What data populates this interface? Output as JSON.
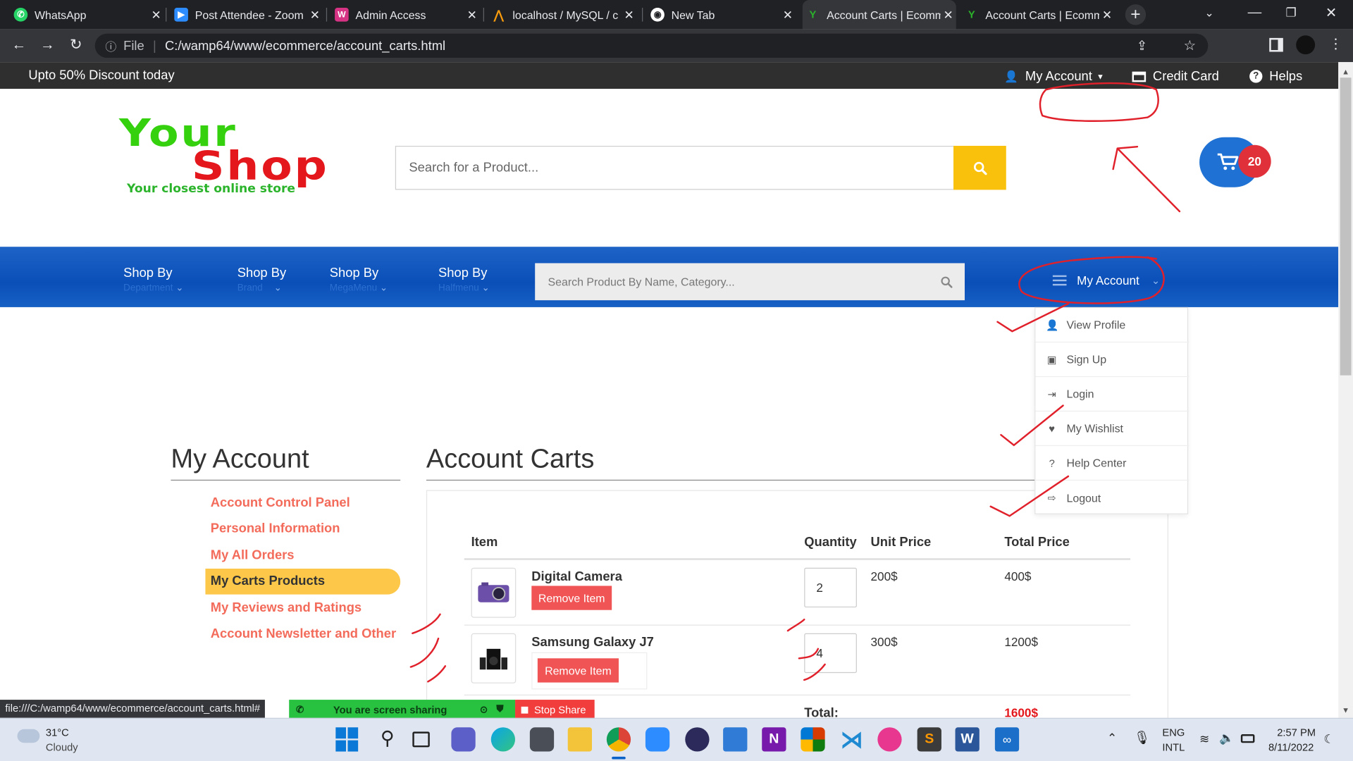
{
  "browser": {
    "tabs": [
      {
        "title": "WhatsApp",
        "icon": "whatsapp-icon",
        "color": "#25d366"
      },
      {
        "title": "Post Attendee - Zoom",
        "icon": "zoom-icon",
        "color": "#2d8cff"
      },
      {
        "title": "Admin Access",
        "icon": "admin-icon",
        "color": "#d63384"
      },
      {
        "title": "localhost / MySQL / c",
        "icon": "phpmyadmin-icon",
        "color": "#f89c0e"
      },
      {
        "title": "New Tab",
        "icon": "chrome-icon",
        "color": "#ffffff"
      },
      {
        "title": "Account Carts | Ecomm",
        "icon": "shop-icon",
        "color": "#2bb42b"
      },
      {
        "title": "Account Carts | Ecomm",
        "icon": "shop-icon",
        "color": "#2bb42b"
      }
    ],
    "active_tab": 5,
    "url_scheme": "File",
    "url": "C:/wamp64/www/ecommerce/account_carts.html",
    "status_url": "file:///C:/wamp64/www/ecommerce/account_carts.html#"
  },
  "topbar": {
    "promo": "Upto 50% Discount today",
    "my_account": "My Account",
    "credit_card": "Credit Card",
    "helps": "Helps"
  },
  "logo": {
    "line1": "Your",
    "line2": "Shop",
    "tagline": "Your closest online store"
  },
  "search": {
    "placeholder": "Search for a Product..."
  },
  "cart": {
    "count": "20"
  },
  "nav": {
    "items": [
      {
        "label": "Shop By",
        "sub": "Department"
      },
      {
        "label": "Shop By",
        "sub": "Brand"
      },
      {
        "label": "Shop By",
        "sub": "MegaMenu"
      },
      {
        "label": "Shop By",
        "sub": "Halfmenu"
      }
    ],
    "search_placeholder": "Search Product By Name, Category...",
    "account_label": "My Account"
  },
  "dropdown": [
    {
      "label": "View Profile",
      "icon": "user-icon"
    },
    {
      "label": "Sign Up",
      "icon": "signup-icon"
    },
    {
      "label": "Login",
      "icon": "login-icon"
    },
    {
      "label": "My Wishlist",
      "icon": "heart-icon"
    },
    {
      "label": "Help Center",
      "icon": "question-icon"
    },
    {
      "label": "Logout",
      "icon": "logout-icon"
    }
  ],
  "sidebar": {
    "title": "My Account",
    "links": [
      "Account Control Panel",
      "Personal Information",
      "My All Orders",
      "My Carts Products",
      "My Reviews and Ratings",
      "Account Newsletter and Other"
    ],
    "active_index": 3
  },
  "carts": {
    "title": "Account Carts",
    "headers": {
      "item": "Item",
      "quantity": "Quantity",
      "unit_price": "Unit Price",
      "total_price": "Total Price"
    },
    "rows": [
      {
        "name": "Digital Camera",
        "qty": "2",
        "unit": "200$",
        "total": "400$",
        "remove": "Remove Item"
      },
      {
        "name": "Samsung Galaxy J7",
        "qty": "4",
        "unit": "300$",
        "total": "1200$",
        "remove": "Remove Item"
      }
    ],
    "total_label": "Total:",
    "total_value": "1600$"
  },
  "screenshare": {
    "status": "You are screen sharing",
    "stop": "Stop Share"
  },
  "taskbar": {
    "weather_temp": "31°C",
    "weather_desc": "Cloudy",
    "lang1": "ENG",
    "lang2": "INTL",
    "time": "2:57 PM",
    "date": "8/11/2022"
  },
  "colors": {
    "accent_blue": "#0a4fb8",
    "accent_yellow": "#f9c10b",
    "link_red": "#f36b5a",
    "annotation": "#e0202a"
  }
}
